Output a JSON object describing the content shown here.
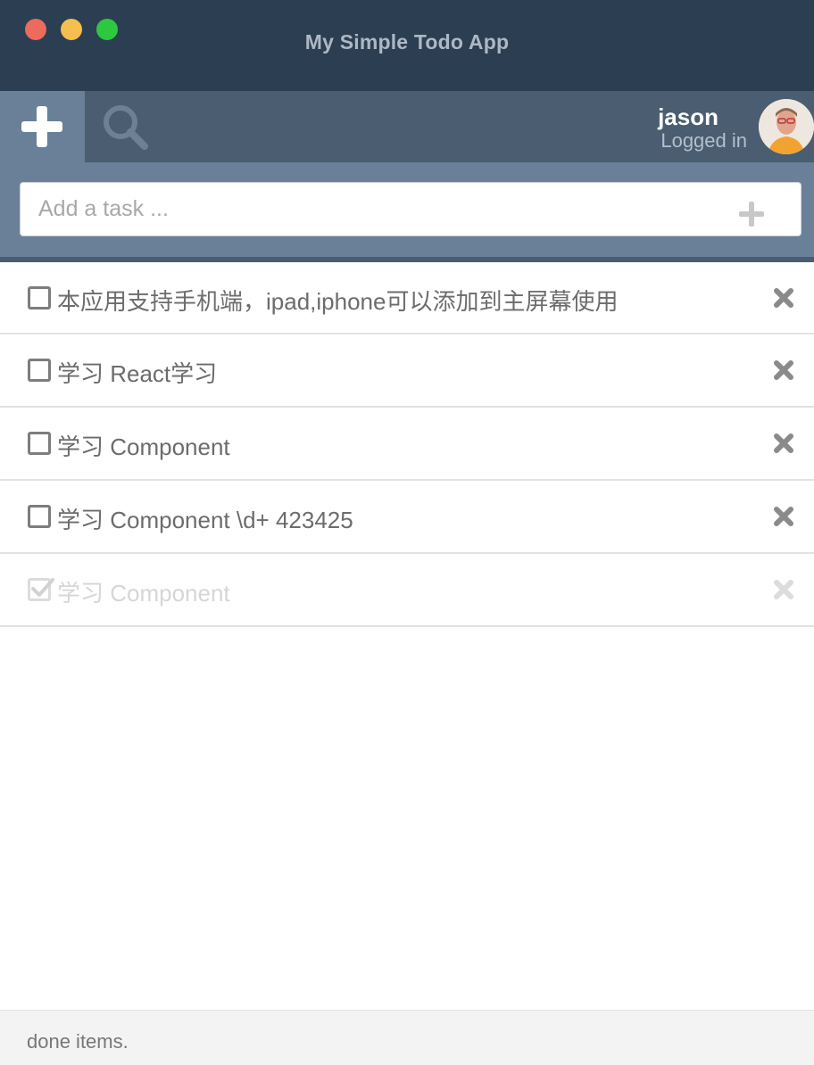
{
  "window": {
    "title": "My Simple Todo App"
  },
  "toolbar": {
    "add_tab_icon": "plus-icon",
    "search_tab_icon": "search-icon",
    "user": {
      "name": "jason",
      "status": "Logged in"
    }
  },
  "task_input": {
    "placeholder": "Add a task ...",
    "value": ""
  },
  "tasks": [
    {
      "text": "本应用支持手机端，ipad,iphone可以添加到主屏幕使用",
      "done": false
    },
    {
      "text": "学习 React学习",
      "done": false
    },
    {
      "text": "学习 Component",
      "done": false
    },
    {
      "text": "学习 Component \\d+ 423425",
      "done": false
    },
    {
      "text": "学习 Component",
      "done": true
    }
  ],
  "footer": {
    "text": "done items."
  },
  "colors": {
    "titlebar": "#2b3e52",
    "toolbar": "#4a5d71",
    "accent": "#6a8099",
    "traffic_close": "#ec6a5e",
    "traffic_minimize": "#f4bf4f",
    "traffic_maximize": "#2dc840"
  }
}
